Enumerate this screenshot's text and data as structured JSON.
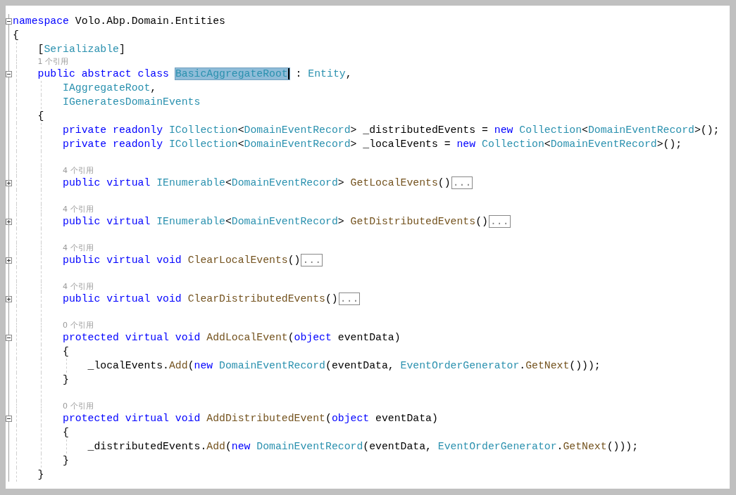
{
  "editor": {
    "lines": [
      {
        "kind": "code",
        "folded": false,
        "tokens": [
          {
            "kind": "keyword",
            "text": "namespace "
          },
          {
            "kind": "plain",
            "text": "Volo.Abp.Domain.Entities"
          }
        ]
      },
      {
        "kind": "code",
        "tokens": [
          {
            "kind": "plain",
            "text": "{"
          }
        ],
        "children": [
          {
            "kind": "code",
            "tokens": [
              {
                "kind": "plain",
                "text": "["
              },
              {
                "kind": "type",
                "text": "Serializable"
              },
              {
                "kind": "plain",
                "text": "]"
              }
            ]
          },
          {
            "kind": "lens",
            "text": "1 个引用"
          },
          {
            "kind": "code",
            "folded": false,
            "tokens": [
              {
                "kind": "keyword",
                "text": "public abstract class "
              },
              {
                "kind": "highlight",
                "text": "BasicAggregateRoot"
              },
              {
                "kind": "plain",
                "text": " : "
              },
              {
                "kind": "type",
                "text": "Entity"
              },
              {
                "kind": "plain",
                "text": ","
              }
            ],
            "children": [
              {
                "kind": "code",
                "tokens": [
                  {
                    "kind": "type",
                    "text": "IAggregateRoot"
                  },
                  {
                    "kind": "plain",
                    "text": ","
                  }
                ]
              },
              {
                "kind": "code",
                "tokens": [
                  {
                    "kind": "type",
                    "text": "IGeneratesDomainEvents"
                  }
                ]
              }
            ]
          },
          {
            "kind": "code",
            "tokens": [
              {
                "kind": "plain",
                "text": "{"
              }
            ],
            "children": [
              {
                "kind": "code",
                "tokens": [
                  {
                    "kind": "keyword",
                    "text": "private readonly "
                  },
                  {
                    "kind": "type",
                    "text": "ICollection"
                  },
                  {
                    "kind": "plain",
                    "text": "<"
                  },
                  {
                    "kind": "type",
                    "text": "DomainEventRecord"
                  },
                  {
                    "kind": "plain",
                    "text": "> _distributedEvents = "
                  },
                  {
                    "kind": "keyword",
                    "text": "new "
                  },
                  {
                    "kind": "type",
                    "text": "Collection"
                  },
                  {
                    "kind": "plain",
                    "text": "<"
                  },
                  {
                    "kind": "type",
                    "text": "DomainEventRecord"
                  },
                  {
                    "kind": "plain",
                    "text": ">();"
                  }
                ]
              },
              {
                "kind": "code",
                "tokens": [
                  {
                    "kind": "keyword",
                    "text": "private readonly "
                  },
                  {
                    "kind": "type",
                    "text": "ICollection"
                  },
                  {
                    "kind": "plain",
                    "text": "<"
                  },
                  {
                    "kind": "type",
                    "text": "DomainEventRecord"
                  },
                  {
                    "kind": "plain",
                    "text": "> _localEvents = "
                  },
                  {
                    "kind": "keyword",
                    "text": "new "
                  },
                  {
                    "kind": "type",
                    "text": "Collection"
                  },
                  {
                    "kind": "plain",
                    "text": "<"
                  },
                  {
                    "kind": "type",
                    "text": "DomainEventRecord"
                  },
                  {
                    "kind": "plain",
                    "text": ">();"
                  }
                ]
              },
              {
                "kind": "blank"
              },
              {
                "kind": "lens",
                "text": "4 个引用"
              },
              {
                "kind": "code",
                "folded": true,
                "tokens": [
                  {
                    "kind": "keyword",
                    "text": "public virtual "
                  },
                  {
                    "kind": "type",
                    "text": "IEnumerable"
                  },
                  {
                    "kind": "plain",
                    "text": "<"
                  },
                  {
                    "kind": "type",
                    "text": "DomainEventRecord"
                  },
                  {
                    "kind": "plain",
                    "text": "> "
                  },
                  {
                    "kind": "method",
                    "text": "GetLocalEvents"
                  },
                  {
                    "kind": "plain",
                    "text": "()"
                  },
                  {
                    "kind": "ellipsis",
                    "text": "..."
                  }
                ]
              },
              {
                "kind": "blank"
              },
              {
                "kind": "lens",
                "text": "4 个引用"
              },
              {
                "kind": "code",
                "folded": true,
                "tokens": [
                  {
                    "kind": "keyword",
                    "text": "public virtual "
                  },
                  {
                    "kind": "type",
                    "text": "IEnumerable"
                  },
                  {
                    "kind": "plain",
                    "text": "<"
                  },
                  {
                    "kind": "type",
                    "text": "DomainEventRecord"
                  },
                  {
                    "kind": "plain",
                    "text": "> "
                  },
                  {
                    "kind": "method",
                    "text": "GetDistributedEvents"
                  },
                  {
                    "kind": "plain",
                    "text": "()"
                  },
                  {
                    "kind": "ellipsis",
                    "text": "..."
                  }
                ]
              },
              {
                "kind": "blank"
              },
              {
                "kind": "lens",
                "text": "4 个引用"
              },
              {
                "kind": "code",
                "folded": true,
                "tokens": [
                  {
                    "kind": "keyword",
                    "text": "public virtual void "
                  },
                  {
                    "kind": "method",
                    "text": "ClearLocalEvents"
                  },
                  {
                    "kind": "plain",
                    "text": "()"
                  },
                  {
                    "kind": "ellipsis",
                    "text": "..."
                  }
                ]
              },
              {
                "kind": "blank"
              },
              {
                "kind": "lens",
                "text": "4 个引用"
              },
              {
                "kind": "code",
                "folded": true,
                "tokens": [
                  {
                    "kind": "keyword",
                    "text": "public virtual void "
                  },
                  {
                    "kind": "method",
                    "text": "ClearDistributedEvents"
                  },
                  {
                    "kind": "plain",
                    "text": "()"
                  },
                  {
                    "kind": "ellipsis",
                    "text": "..."
                  }
                ]
              },
              {
                "kind": "blank"
              },
              {
                "kind": "lens",
                "text": "0 个引用"
              },
              {
                "kind": "code",
                "folded": false,
                "tokens": [
                  {
                    "kind": "keyword",
                    "text": "protected virtual void "
                  },
                  {
                    "kind": "method",
                    "text": "AddLocalEvent"
                  },
                  {
                    "kind": "plain",
                    "text": "("
                  },
                  {
                    "kind": "keyword",
                    "text": "object "
                  },
                  {
                    "kind": "plain",
                    "text": "eventData)"
                  }
                ]
              },
              {
                "kind": "code",
                "tokens": [
                  {
                    "kind": "plain",
                    "text": "{"
                  }
                ],
                "children": [
                  {
                    "kind": "code",
                    "tokens": [
                      {
                        "kind": "plain",
                        "text": "_localEvents."
                      },
                      {
                        "kind": "method",
                        "text": "Add"
                      },
                      {
                        "kind": "plain",
                        "text": "("
                      },
                      {
                        "kind": "keyword",
                        "text": "new "
                      },
                      {
                        "kind": "type",
                        "text": "DomainEventRecord"
                      },
                      {
                        "kind": "plain",
                        "text": "(eventData, "
                      },
                      {
                        "kind": "type",
                        "text": "EventOrderGenerator"
                      },
                      {
                        "kind": "plain",
                        "text": "."
                      },
                      {
                        "kind": "method",
                        "text": "GetNext"
                      },
                      {
                        "kind": "plain",
                        "text": "()));"
                      }
                    ]
                  }
                ]
              },
              {
                "kind": "code",
                "tokens": [
                  {
                    "kind": "plain",
                    "text": "}"
                  }
                ]
              },
              {
                "kind": "blank"
              },
              {
                "kind": "lens",
                "text": "0 个引用"
              },
              {
                "kind": "code",
                "folded": false,
                "tokens": [
                  {
                    "kind": "keyword",
                    "text": "protected virtual void "
                  },
                  {
                    "kind": "method",
                    "text": "AddDistributedEvent"
                  },
                  {
                    "kind": "plain",
                    "text": "("
                  },
                  {
                    "kind": "keyword",
                    "text": "object "
                  },
                  {
                    "kind": "plain",
                    "text": "eventData)"
                  }
                ]
              },
              {
                "kind": "code",
                "tokens": [
                  {
                    "kind": "plain",
                    "text": "{"
                  }
                ],
                "children": [
                  {
                    "kind": "code",
                    "tokens": [
                      {
                        "kind": "plain",
                        "text": "_distributedEvents."
                      },
                      {
                        "kind": "method",
                        "text": "Add"
                      },
                      {
                        "kind": "plain",
                        "text": "("
                      },
                      {
                        "kind": "keyword",
                        "text": "new "
                      },
                      {
                        "kind": "type",
                        "text": "DomainEventRecord"
                      },
                      {
                        "kind": "plain",
                        "text": "(eventData, "
                      },
                      {
                        "kind": "type",
                        "text": "EventOrderGenerator"
                      },
                      {
                        "kind": "plain",
                        "text": "."
                      },
                      {
                        "kind": "method",
                        "text": "GetNext"
                      },
                      {
                        "kind": "plain",
                        "text": "()));"
                      }
                    ]
                  }
                ]
              },
              {
                "kind": "code",
                "tokens": [
                  {
                    "kind": "plain",
                    "text": "}"
                  }
                ]
              }
            ]
          },
          {
            "kind": "code",
            "tokens": [
              {
                "kind": "plain",
                "text": "}"
              }
            ]
          }
        ]
      }
    ]
  }
}
